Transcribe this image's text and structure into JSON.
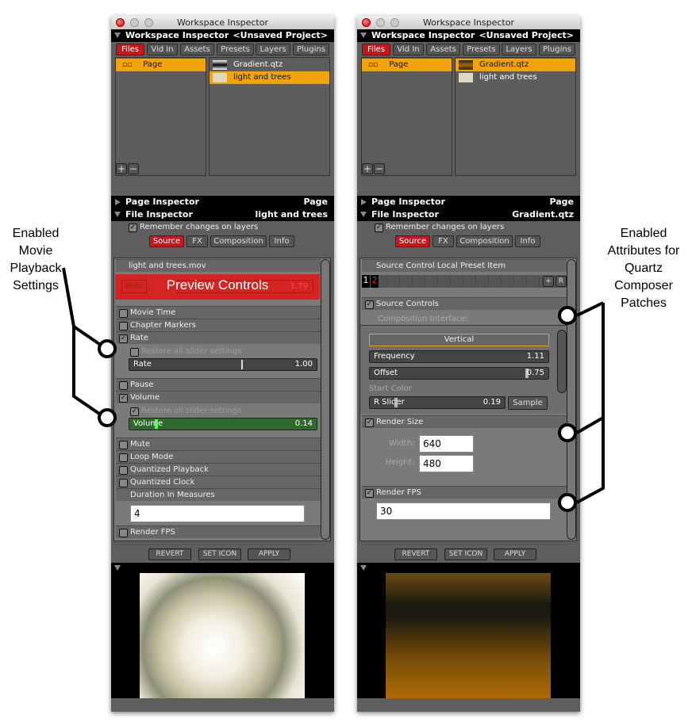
{
  "window_title": "Workspace Inspector",
  "header": {
    "title": "Workspace Inspector",
    "project": "<Unsaved Project>"
  },
  "tabs": [
    "Files",
    "Vid In",
    "Assets",
    "Presets",
    "Layers",
    "Plugins"
  ],
  "pages": [
    "Page"
  ],
  "files": [
    "Gradient.qtz",
    "light and trees"
  ],
  "page_inspector": {
    "label": "Page Inspector",
    "value": "Page"
  },
  "file_inspector_label": "File Inspector",
  "remember": "Remember changes on layers",
  "source_tabs": [
    "Source",
    "FX",
    "Composition",
    "Info"
  ],
  "buttons": {
    "revert": "REVERT",
    "set_icon": "SET ICON",
    "apply": "APPLY",
    "plus": "+",
    "minus": "−"
  },
  "left": {
    "selected_file": "light and trees",
    "movie_file": "light and trees.mov",
    "preview_overlay": "Preview Controls",
    "preview_mute": "Mute",
    "preview_value": "1.79",
    "rows": {
      "movie_time": "Movie Time",
      "chapter_markers": "Chapter Markers",
      "rate": "Rate",
      "pause": "Pause",
      "volume": "Volume",
      "mute": "Mute",
      "loop_mode": "Loop Mode",
      "quantized_playback": "Quantized Playback",
      "quantized_clock": "Quantized Clock",
      "duration": "Duration In Measures",
      "render_fps": "Render FPS"
    },
    "restore": "Restore all slider settings",
    "rate_slider": {
      "label": "Rate",
      "value": "1.00"
    },
    "volume_slider": {
      "label": "Volume",
      "value": "0.14"
    },
    "duration_value": "4"
  },
  "right": {
    "selected_file": "Gradient.qtz",
    "preset_header": "Source Control Local Preset Item",
    "presets": [
      "1",
      "2"
    ],
    "preset_add": "+",
    "preset_reset": "R",
    "source_controls": "Source Controls",
    "composition_interface": "Composition Interface:",
    "vertical": "Vertical",
    "frequency": {
      "label": "Frequency",
      "value": "1.11"
    },
    "offset": {
      "label": "Offset",
      "value": "0.75"
    },
    "start_color": "Start Color",
    "r_slider": {
      "label": "R Slider",
      "value": "0.19"
    },
    "sample": "Sample",
    "render_size": "Render Size",
    "width_label": "Width:",
    "width": "640",
    "height_label": "Height:",
    "height": "480",
    "render_fps": "Render FPS",
    "fps": "30"
  },
  "annotations": {
    "left": [
      "Enabled",
      "Movie",
      "Playback",
      "Settings"
    ],
    "right": [
      "Enabled",
      "Attributes for",
      "Quartz",
      "Composer",
      "Patches"
    ]
  }
}
